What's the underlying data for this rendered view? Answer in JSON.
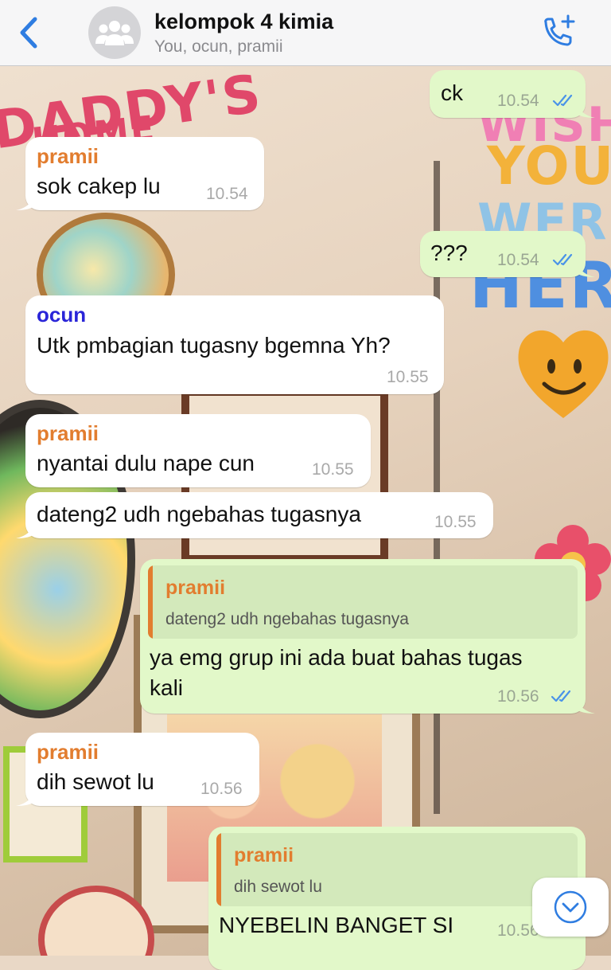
{
  "header": {
    "title": "kelompok 4 kimia",
    "subtitle": "You, ocun, pramii"
  },
  "colors": {
    "accent": "#2f7de1",
    "incoming_bubble": "#ffffff",
    "outgoing_bubble": "#e2f8c9",
    "sender_pramii": "#e27d2f",
    "sender_ocun": "#2a25d8"
  },
  "wallpaper": {
    "text_daddy": "DADDY'S",
    "text_home": "HOME",
    "text_wish": "WISH",
    "text_you": "YOU",
    "text_were": "WERE",
    "text_here": "HERE"
  },
  "messages": [
    {
      "dir": "out",
      "text": "ck",
      "time": "10.54"
    },
    {
      "dir": "in",
      "sender": "pramii",
      "text": "sok cakep lu",
      "time": "10.54"
    },
    {
      "dir": "out",
      "text": "???",
      "time": "10.54"
    },
    {
      "dir": "in",
      "sender": "ocun",
      "text": "Utk pmbagian tugasny bgemna Yh?",
      "time": "10.55"
    },
    {
      "dir": "in",
      "sender": "pramii",
      "text": "nyantai dulu nape cun",
      "time": "10.55"
    },
    {
      "dir": "in",
      "text": "dateng2 udh ngebahas tugasnya",
      "time": "10.55"
    },
    {
      "dir": "out",
      "reply_sender": "pramii",
      "reply_text": "dateng2 udh ngebahas tugasnya",
      "line1": "ya emg grup ini ada buat bahas tugas",
      "line2": "kali",
      "time": "10.56"
    },
    {
      "dir": "in",
      "sender": "pramii",
      "text": "dih sewot lu",
      "time": "10.56"
    },
    {
      "dir": "out",
      "reply_sender": "pramii",
      "reply_text": "dih sewot lu",
      "text": "NYEBELIN BANGET SI",
      "time": "10.56"
    }
  ]
}
